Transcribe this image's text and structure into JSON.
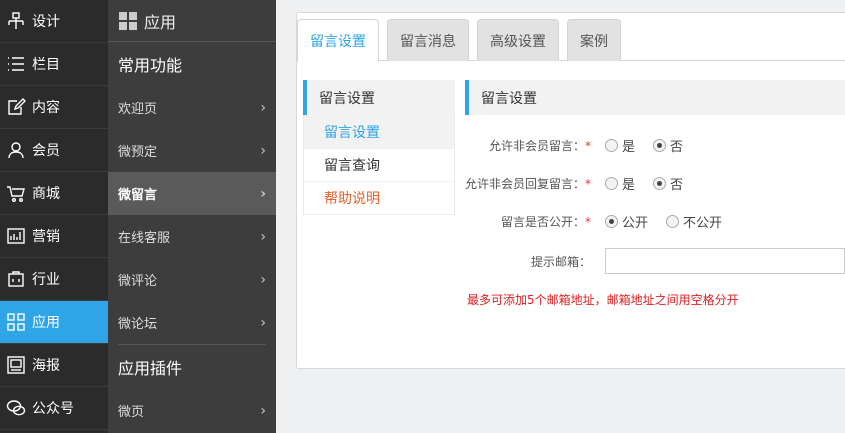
{
  "rail": {
    "items": [
      {
        "label": "设计",
        "icon": "design-icon"
      },
      {
        "label": "栏目",
        "icon": "list-icon"
      },
      {
        "label": "内容",
        "icon": "edit-icon"
      },
      {
        "label": "会员",
        "icon": "user-icon"
      },
      {
        "label": "商城",
        "icon": "cart-icon"
      },
      {
        "label": "营销",
        "icon": "chart-icon"
      },
      {
        "label": "行业",
        "icon": "briefcase-icon"
      },
      {
        "label": "应用",
        "icon": "apps-icon"
      },
      {
        "label": "海报",
        "icon": "poster-icon"
      },
      {
        "label": "公众号",
        "icon": "wechat-icon"
      }
    ],
    "active_color": "#2fa4e7"
  },
  "sidebar": {
    "title": "应用",
    "group1": "常用功能",
    "items1": [
      "欢迎页",
      "微预定",
      "微留言",
      "在线客服",
      "微评论",
      "微论坛"
    ],
    "group2": "应用插件",
    "items2": [
      "微页"
    ]
  },
  "tabs": [
    "留言设置",
    "留言消息",
    "高级设置",
    "案例"
  ],
  "subnav": {
    "title": "留言设置",
    "items": [
      "留言设置",
      "留言查询",
      "帮助说明"
    ]
  },
  "form": {
    "section_title": "留言设置",
    "row1": {
      "label": "允许非会员留言：",
      "opt_yes": "是",
      "opt_no": "否"
    },
    "row2": {
      "label": "允许非会员回复留言：",
      "opt_yes": "是",
      "opt_no": "否"
    },
    "row3": {
      "label": "留言是否公开：",
      "opt_yes": "公开",
      "opt_no": "不公开"
    },
    "email": {
      "label": "提示邮箱：",
      "value": ""
    },
    "hint": "最多可添加5个邮箱地址，邮箱地址之间用空格分开",
    "required_mark": "*"
  }
}
